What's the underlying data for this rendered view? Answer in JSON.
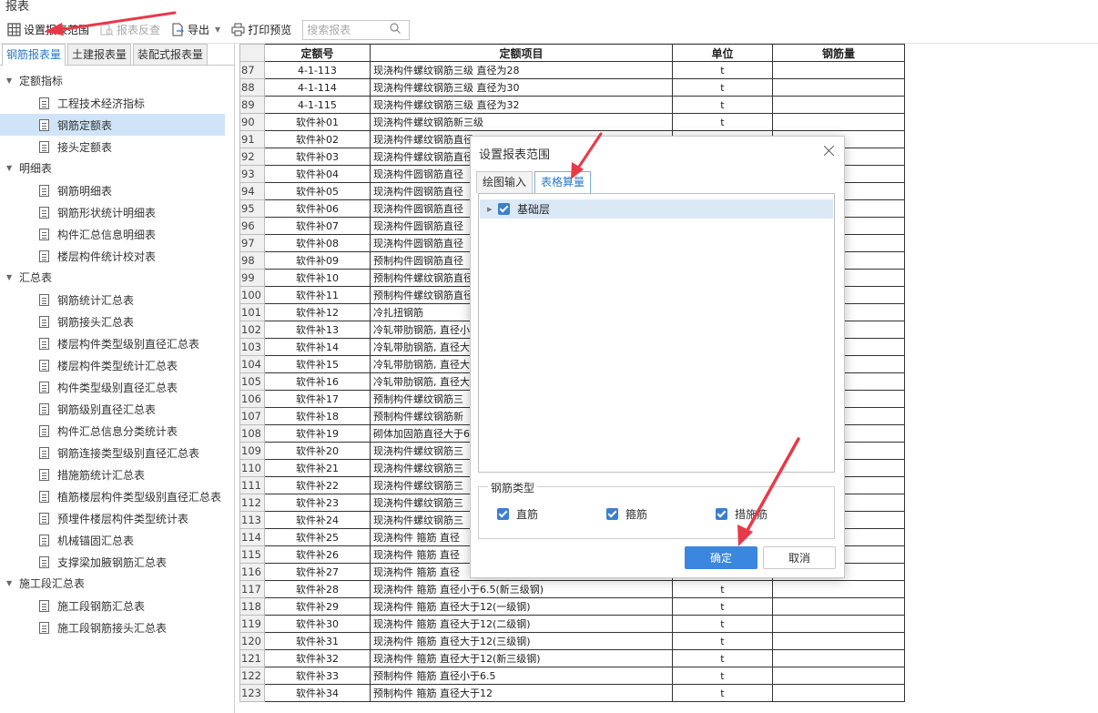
{
  "app": {
    "title": "报表"
  },
  "toolbar": {
    "set_range": "设置报表范围",
    "reverse_check": "报表反查",
    "export": "导出",
    "print_preview": "打印预览",
    "search_placeholder": "搜索报表"
  },
  "left_tabs": [
    "钢筋报表量",
    "土建报表量",
    "装配式报表量"
  ],
  "tree": {
    "groups": [
      {
        "label": "定额指标",
        "items": [
          "工程技术经济指标",
          "钢筋定额表",
          "接头定额表"
        ]
      },
      {
        "label": "明细表",
        "items": [
          "钢筋明细表",
          "钢筋形状统计明细表",
          "构件汇总信息明细表",
          "楼层构件统计校对表"
        ]
      },
      {
        "label": "汇总表",
        "items": [
          "钢筋统计汇总表",
          "钢筋接头汇总表",
          "楼层构件类型级别直径汇总表",
          "楼层构件类型统计汇总表",
          "构件类型级别直径汇总表",
          "钢筋级别直径汇总表",
          "构件汇总信息分类统计表",
          "钢筋连接类型级别直径汇总表",
          "措施筋统计汇总表",
          "植筋楼层构件类型级别直径汇总表",
          "预埋件楼层构件类型统计表",
          "机械锚固汇总表",
          "支撑梁加腋钢筋汇总表"
        ]
      },
      {
        "label": "施工段汇总表",
        "items": [
          "施工段钢筋汇总表",
          "施工段钢筋接头汇总表"
        ]
      }
    ],
    "selected": "钢筋定额表"
  },
  "sheet": {
    "headers": {
      "code": "定额号",
      "item": "定额项目",
      "unit": "单位",
      "qty": "钢筋量"
    },
    "rows": [
      {
        "n": "87",
        "code": "4-1-113",
        "item": "现浇构件螺纹钢筋三级 直径为28",
        "unit": "t"
      },
      {
        "n": "88",
        "code": "4-1-114",
        "item": "现浇构件螺纹钢筋三级 直径为30",
        "unit": "t"
      },
      {
        "n": "89",
        "code": "4-1-115",
        "item": "现浇构件螺纹钢筋三级 直径为32",
        "unit": "t"
      },
      {
        "n": "90",
        "code": "软件补01",
        "item": "现浇构件螺纹钢筋新三级",
        "unit": "t"
      },
      {
        "n": "91",
        "code": "软件补02",
        "item": "现浇构件螺纹钢筋直径",
        "unit": ""
      },
      {
        "n": "92",
        "code": "软件补03",
        "item": "现浇构件螺纹钢筋直径",
        "unit": ""
      },
      {
        "n": "93",
        "code": "软件补04",
        "item": "现浇构件圆钢筋直径",
        "unit": ""
      },
      {
        "n": "94",
        "code": "软件补05",
        "item": "现浇构件圆钢筋直径",
        "unit": ""
      },
      {
        "n": "95",
        "code": "软件补06",
        "item": "现浇构件圆钢筋直径",
        "unit": ""
      },
      {
        "n": "96",
        "code": "软件补07",
        "item": "现浇构件圆钢筋直径",
        "unit": ""
      },
      {
        "n": "97",
        "code": "软件补08",
        "item": "现浇构件圆钢筋直径",
        "unit": ""
      },
      {
        "n": "98",
        "code": "软件补09",
        "item": "预制构件圆钢筋直径",
        "unit": ""
      },
      {
        "n": "99",
        "code": "软件补10",
        "item": "预制构件螺纹钢筋直径",
        "unit": ""
      },
      {
        "n": "100",
        "code": "软件补11",
        "item": "预制构件螺纹钢筋直径",
        "unit": ""
      },
      {
        "n": "101",
        "code": "软件补12",
        "item": "冷扎扭钢筋",
        "unit": ""
      },
      {
        "n": "102",
        "code": "软件补13",
        "item": "冷轧带肋钢筋, 直径小",
        "unit": ""
      },
      {
        "n": "103",
        "code": "软件补14",
        "item": "冷轧带肋钢筋, 直径大",
        "unit": ""
      },
      {
        "n": "104",
        "code": "软件补15",
        "item": "冷轧带肋钢筋, 直径大",
        "unit": ""
      },
      {
        "n": "105",
        "code": "软件补16",
        "item": "冷轧带肋钢筋, 直径大",
        "unit": ""
      },
      {
        "n": "106",
        "code": "软件补17",
        "item": "预制构件螺纹钢筋三",
        "unit": ""
      },
      {
        "n": "107",
        "code": "软件补18",
        "item": "预制构件螺纹钢筋新",
        "unit": ""
      },
      {
        "n": "108",
        "code": "软件补19",
        "item": "砌体加固筋直径大于6",
        "unit": ""
      },
      {
        "n": "109",
        "code": "软件补20",
        "item": "现浇构件螺纹钢筋三",
        "unit": ""
      },
      {
        "n": "110",
        "code": "软件补21",
        "item": "现浇构件螺纹钢筋三",
        "unit": ""
      },
      {
        "n": "111",
        "code": "软件补22",
        "item": "现浇构件螺纹钢筋三",
        "unit": ""
      },
      {
        "n": "112",
        "code": "软件补23",
        "item": "现浇构件螺纹钢筋三",
        "unit": ""
      },
      {
        "n": "113",
        "code": "软件补24",
        "item": "现浇构件螺纹钢筋三",
        "unit": ""
      },
      {
        "n": "114",
        "code": "软件补25",
        "item": "现浇构件 箍筋 直径",
        "unit": ""
      },
      {
        "n": "115",
        "code": "软件补26",
        "item": "现浇构件 箍筋 直径",
        "unit": ""
      },
      {
        "n": "116",
        "code": "软件补27",
        "item": "现浇构件 箍筋 直径",
        "unit": ""
      },
      {
        "n": "117",
        "code": "软件补28",
        "item": "现浇构件 箍筋 直径小于6.5(新三级钢)",
        "unit": "t"
      },
      {
        "n": "118",
        "code": "软件补29",
        "item": "现浇构件 箍筋 直径大于12(一级钢)",
        "unit": "t"
      },
      {
        "n": "119",
        "code": "软件补30",
        "item": "现浇构件 箍筋 直径大于12(二级钢)",
        "unit": "t"
      },
      {
        "n": "120",
        "code": "软件补31",
        "item": "现浇构件 箍筋 直径大于12(三级钢)",
        "unit": "t"
      },
      {
        "n": "121",
        "code": "软件补32",
        "item": "现浇构件 箍筋 直径大于12(新三级钢)",
        "unit": "t"
      },
      {
        "n": "122",
        "code": "软件补33",
        "item": "预制构件 箍筋 直径小于6.5",
        "unit": "t"
      },
      {
        "n": "123",
        "code": "软件补34",
        "item": "预制构件 箍筋 直径大于12",
        "unit": "t"
      }
    ]
  },
  "dialog": {
    "title": "设置报表范围",
    "tabs": [
      "绘图输入",
      "表格算量"
    ],
    "tree_node": "基础层",
    "rebar_types_label": "钢筋类型",
    "options": [
      "直筋",
      "箍筋",
      "措施筋"
    ],
    "ok": "确定",
    "cancel": "取消"
  },
  "colors": {
    "accent": "#3a86e0",
    "annotation": "#e8394a",
    "selection": "#cfe4f8"
  }
}
